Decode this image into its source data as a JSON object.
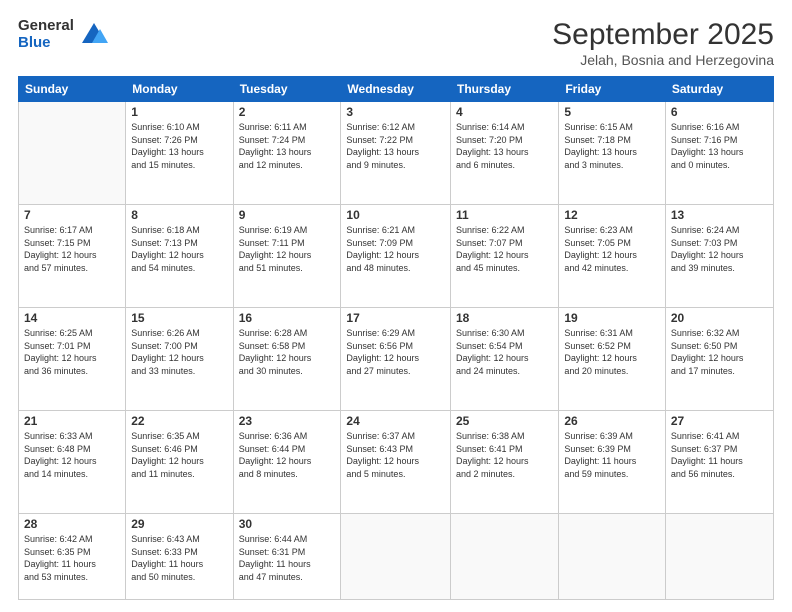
{
  "logo": {
    "general": "General",
    "blue": "Blue"
  },
  "header": {
    "title": "September 2025",
    "subtitle": "Jelah, Bosnia and Herzegovina"
  },
  "weekdays": [
    "Sunday",
    "Monday",
    "Tuesday",
    "Wednesday",
    "Thursday",
    "Friday",
    "Saturday"
  ],
  "weeks": [
    [
      {
        "day": "",
        "info": ""
      },
      {
        "day": "1",
        "info": "Sunrise: 6:10 AM\nSunset: 7:26 PM\nDaylight: 13 hours\nand 15 minutes."
      },
      {
        "day": "2",
        "info": "Sunrise: 6:11 AM\nSunset: 7:24 PM\nDaylight: 13 hours\nand 12 minutes."
      },
      {
        "day": "3",
        "info": "Sunrise: 6:12 AM\nSunset: 7:22 PM\nDaylight: 13 hours\nand 9 minutes."
      },
      {
        "day": "4",
        "info": "Sunrise: 6:14 AM\nSunset: 7:20 PM\nDaylight: 13 hours\nand 6 minutes."
      },
      {
        "day": "5",
        "info": "Sunrise: 6:15 AM\nSunset: 7:18 PM\nDaylight: 13 hours\nand 3 minutes."
      },
      {
        "day": "6",
        "info": "Sunrise: 6:16 AM\nSunset: 7:16 PM\nDaylight: 13 hours\nand 0 minutes."
      }
    ],
    [
      {
        "day": "7",
        "info": "Sunrise: 6:17 AM\nSunset: 7:15 PM\nDaylight: 12 hours\nand 57 minutes."
      },
      {
        "day": "8",
        "info": "Sunrise: 6:18 AM\nSunset: 7:13 PM\nDaylight: 12 hours\nand 54 minutes."
      },
      {
        "day": "9",
        "info": "Sunrise: 6:19 AM\nSunset: 7:11 PM\nDaylight: 12 hours\nand 51 minutes."
      },
      {
        "day": "10",
        "info": "Sunrise: 6:21 AM\nSunset: 7:09 PM\nDaylight: 12 hours\nand 48 minutes."
      },
      {
        "day": "11",
        "info": "Sunrise: 6:22 AM\nSunset: 7:07 PM\nDaylight: 12 hours\nand 45 minutes."
      },
      {
        "day": "12",
        "info": "Sunrise: 6:23 AM\nSunset: 7:05 PM\nDaylight: 12 hours\nand 42 minutes."
      },
      {
        "day": "13",
        "info": "Sunrise: 6:24 AM\nSunset: 7:03 PM\nDaylight: 12 hours\nand 39 minutes."
      }
    ],
    [
      {
        "day": "14",
        "info": "Sunrise: 6:25 AM\nSunset: 7:01 PM\nDaylight: 12 hours\nand 36 minutes."
      },
      {
        "day": "15",
        "info": "Sunrise: 6:26 AM\nSunset: 7:00 PM\nDaylight: 12 hours\nand 33 minutes."
      },
      {
        "day": "16",
        "info": "Sunrise: 6:28 AM\nSunset: 6:58 PM\nDaylight: 12 hours\nand 30 minutes."
      },
      {
        "day": "17",
        "info": "Sunrise: 6:29 AM\nSunset: 6:56 PM\nDaylight: 12 hours\nand 27 minutes."
      },
      {
        "day": "18",
        "info": "Sunrise: 6:30 AM\nSunset: 6:54 PM\nDaylight: 12 hours\nand 24 minutes."
      },
      {
        "day": "19",
        "info": "Sunrise: 6:31 AM\nSunset: 6:52 PM\nDaylight: 12 hours\nand 20 minutes."
      },
      {
        "day": "20",
        "info": "Sunrise: 6:32 AM\nSunset: 6:50 PM\nDaylight: 12 hours\nand 17 minutes."
      }
    ],
    [
      {
        "day": "21",
        "info": "Sunrise: 6:33 AM\nSunset: 6:48 PM\nDaylight: 12 hours\nand 14 minutes."
      },
      {
        "day": "22",
        "info": "Sunrise: 6:35 AM\nSunset: 6:46 PM\nDaylight: 12 hours\nand 11 minutes."
      },
      {
        "day": "23",
        "info": "Sunrise: 6:36 AM\nSunset: 6:44 PM\nDaylight: 12 hours\nand 8 minutes."
      },
      {
        "day": "24",
        "info": "Sunrise: 6:37 AM\nSunset: 6:43 PM\nDaylight: 12 hours\nand 5 minutes."
      },
      {
        "day": "25",
        "info": "Sunrise: 6:38 AM\nSunset: 6:41 PM\nDaylight: 12 hours\nand 2 minutes."
      },
      {
        "day": "26",
        "info": "Sunrise: 6:39 AM\nSunset: 6:39 PM\nDaylight: 11 hours\nand 59 minutes."
      },
      {
        "day": "27",
        "info": "Sunrise: 6:41 AM\nSunset: 6:37 PM\nDaylight: 11 hours\nand 56 minutes."
      }
    ],
    [
      {
        "day": "28",
        "info": "Sunrise: 6:42 AM\nSunset: 6:35 PM\nDaylight: 11 hours\nand 53 minutes."
      },
      {
        "day": "29",
        "info": "Sunrise: 6:43 AM\nSunset: 6:33 PM\nDaylight: 11 hours\nand 50 minutes."
      },
      {
        "day": "30",
        "info": "Sunrise: 6:44 AM\nSunset: 6:31 PM\nDaylight: 11 hours\nand 47 minutes."
      },
      {
        "day": "",
        "info": ""
      },
      {
        "day": "",
        "info": ""
      },
      {
        "day": "",
        "info": ""
      },
      {
        "day": "",
        "info": ""
      }
    ]
  ]
}
